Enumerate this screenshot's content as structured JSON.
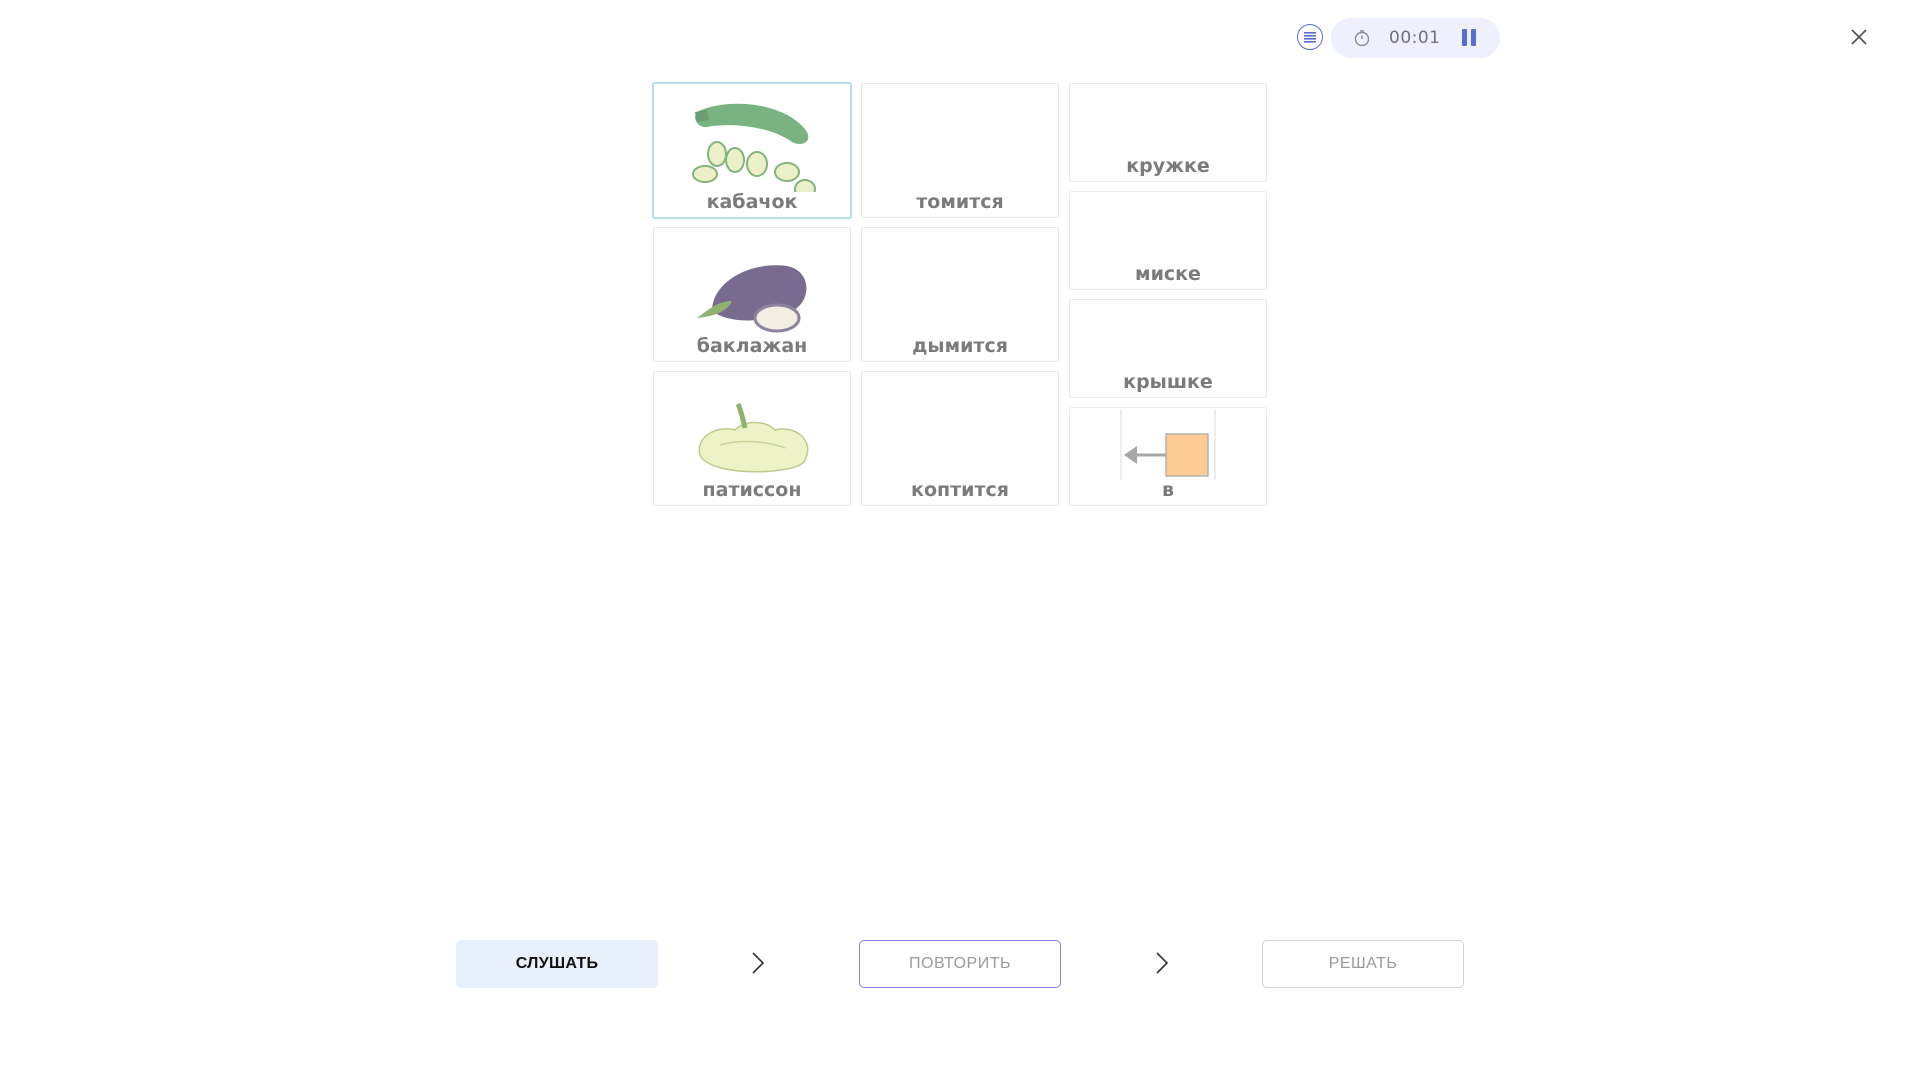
{
  "toolbar": {
    "menu_icon": "list-icon",
    "timer": "00:01",
    "timer_icon": "stopwatch-icon",
    "pause_icon": "pause-icon",
    "close_icon": "close-icon",
    "accent": "#5b6bd6"
  },
  "cards": {
    "col1": [
      {
        "label": "кабачок",
        "image": "zucchini",
        "selected": true
      },
      {
        "label": "баклажан",
        "image": "eggplant"
      },
      {
        "label": "патиссон",
        "image": "pattypan-squash"
      }
    ],
    "col2": [
      {
        "label": "томится"
      },
      {
        "label": "дымится"
      },
      {
        "label": "коптится"
      }
    ],
    "col3": [
      {
        "label": "кружке"
      },
      {
        "label": "миске"
      },
      {
        "label": "крышке"
      },
      {
        "label": "в",
        "image": "arrow-into-box"
      }
    ]
  },
  "actions": {
    "listen": "СЛУШАТЬ",
    "repeat": "ПОВТОРИТЬ",
    "solve": "РЕШАТЬ"
  }
}
